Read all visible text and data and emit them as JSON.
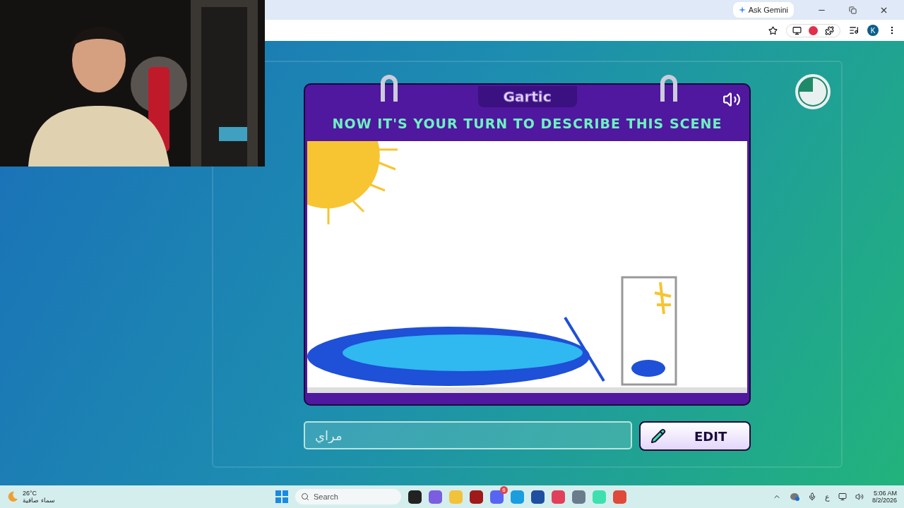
{
  "browser": {
    "gemini_button": "Ask Gemini",
    "profile_initial": "K"
  },
  "game": {
    "logo": "Gartic",
    "instruction": "NOW IT'S YOUR TURN TO DESCRIBE THIS SCENE",
    "answer": {
      "value": "مراي"
    },
    "edit_button": "EDIT"
  },
  "taskbar": {
    "weather": {
      "temperature": "26°C",
      "condition": "سماء صافية"
    },
    "search": {
      "placeholder": "Search"
    },
    "chat_badge": "6",
    "input_language": "ع",
    "time": "5:06 AM",
    "date": "8/2/2026"
  }
}
